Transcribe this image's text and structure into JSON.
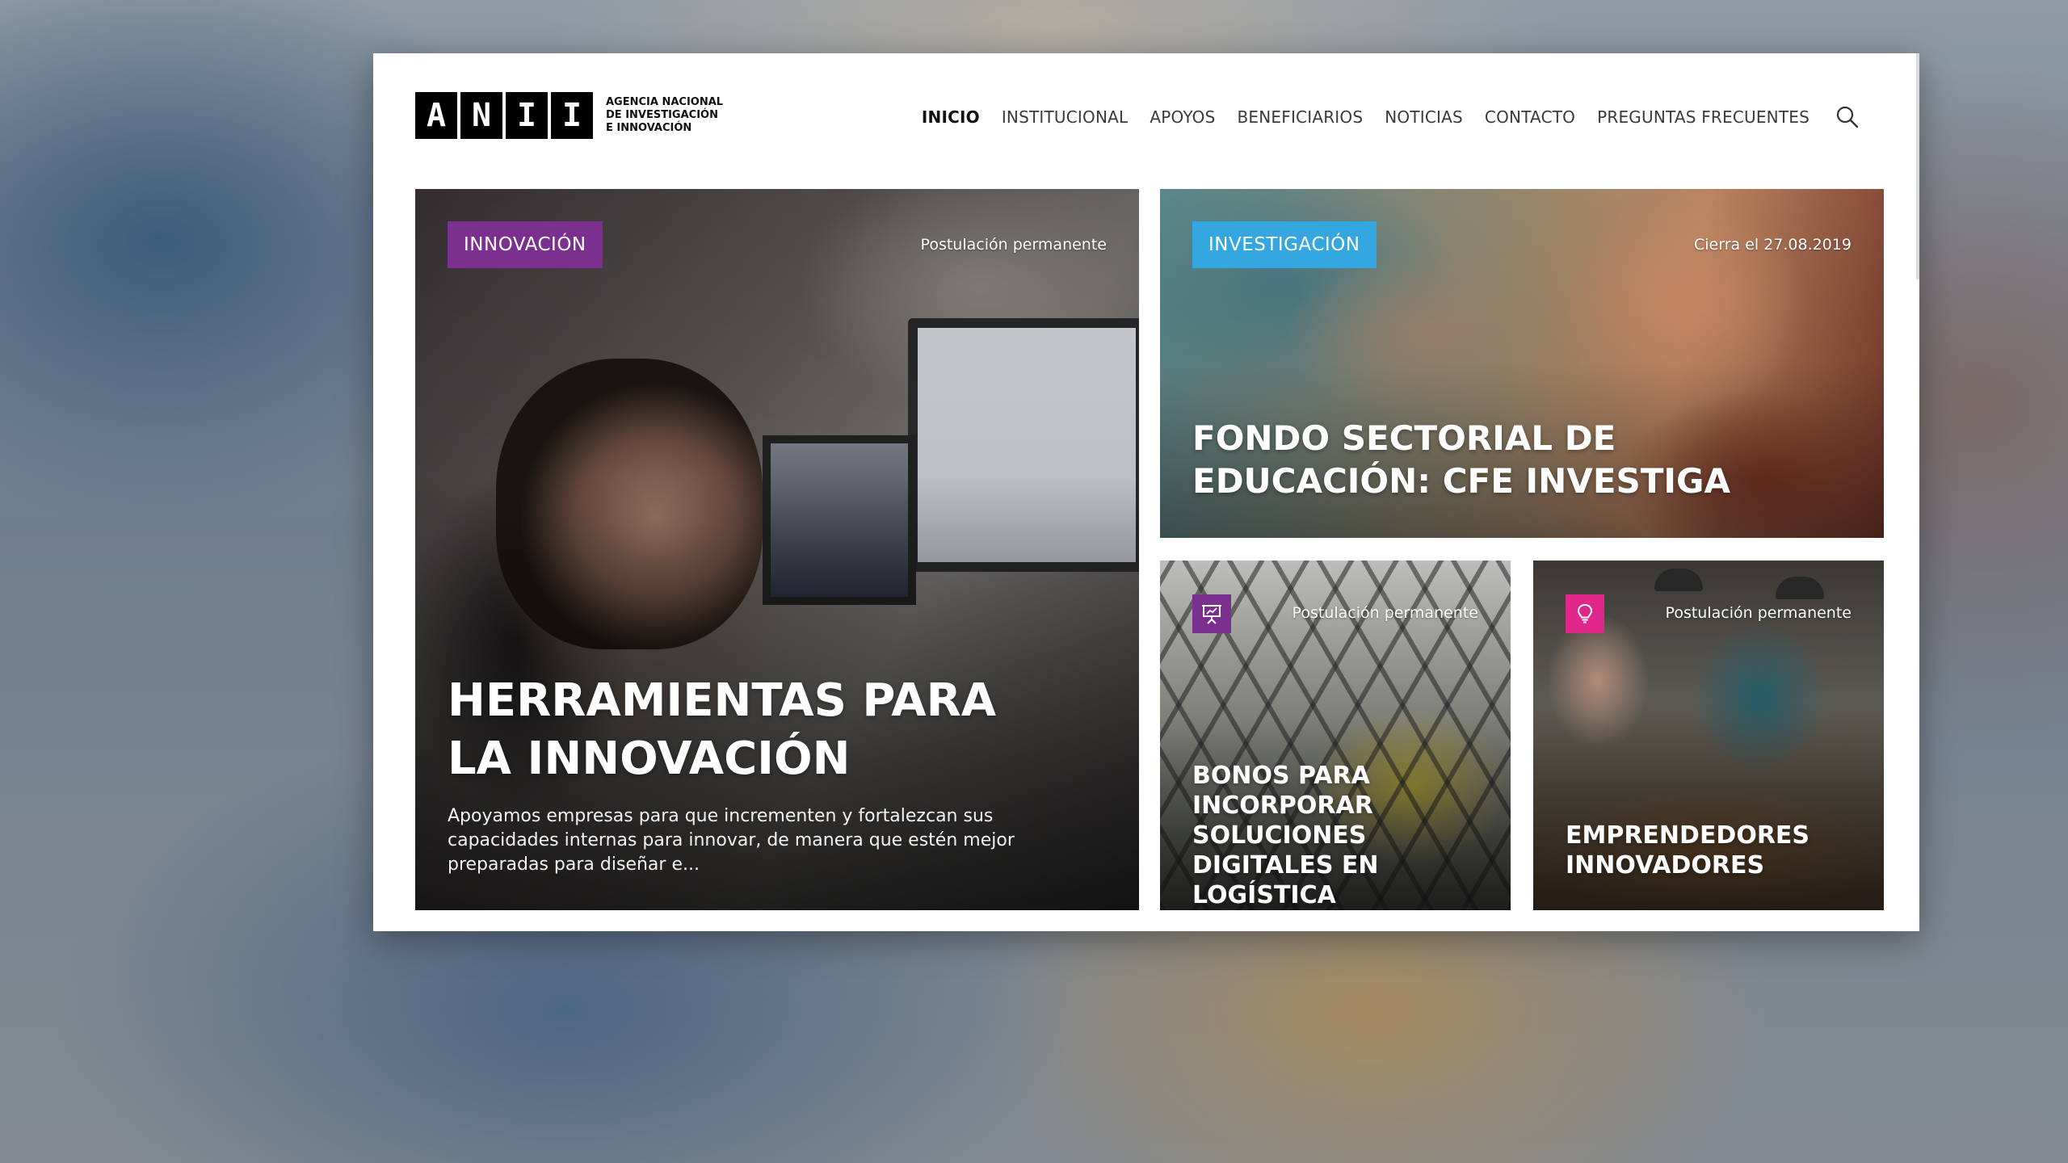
{
  "logo": {
    "letters": [
      "A",
      "N",
      "I",
      "I"
    ],
    "text_lines": [
      "AGENCIA NACIONAL",
      "DE INVESTIGACIÓN",
      "E INNOVACIÓN"
    ]
  },
  "nav": {
    "items": [
      {
        "label": "INICIO",
        "active": true
      },
      {
        "label": "INSTITUCIONAL",
        "active": false
      },
      {
        "label": "APOYOS",
        "active": false
      },
      {
        "label": "BENEFICIARIOS",
        "active": false
      },
      {
        "label": "NOTICIAS",
        "active": false
      },
      {
        "label": "CONTACTO",
        "active": false
      },
      {
        "label": "PREGUNTAS FRECUENTES",
        "active": false
      }
    ],
    "search_icon": "search-icon"
  },
  "cards": [
    {
      "tag": "INNOVACIÓN",
      "tag_color": "#7b2f8e",
      "meta": "Postulación permanente",
      "title": "HERRAMIENTAS PARA LA INNOVACIÓN",
      "description": "Apoyamos empresas para que incrementen y fortalezcan sus capacidades internas para innovar, de manera que estén mejor preparadas para diseñar e..."
    },
    {
      "tag": "INVESTIGACIÓN",
      "tag_color": "#34a7e0",
      "meta": "Cierra el 27.08.2019",
      "title": "FONDO SECTORIAL DE EDUCACIÓN: CFE INVESTIGA"
    },
    {
      "icon": "presentation-icon",
      "icon_color": "#7b2f8e",
      "meta": "Postulación permanente",
      "title": "BONOS PARA INCORPORAR SOLUCIONES DIGITALES EN LOGÍSTICA"
    },
    {
      "icon": "lightbulb-icon",
      "icon_color": "#e0268a",
      "meta": "Postulación permanente",
      "title": "EMPRENDEDORES INNOVADORES"
    }
  ]
}
